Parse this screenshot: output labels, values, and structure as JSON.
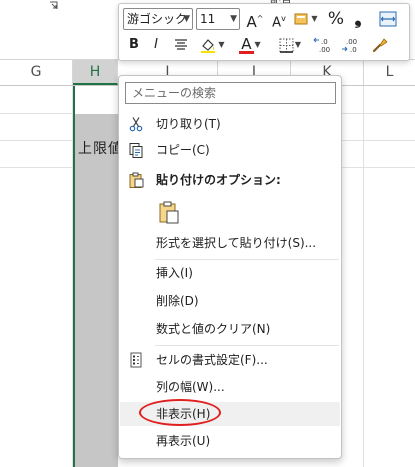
{
  "ribbon": {
    "group_label": "配置"
  },
  "columns": [
    {
      "label": "G",
      "selected": false
    },
    {
      "label": "H",
      "selected": true
    },
    {
      "label": "I",
      "selected": false
    },
    {
      "label": "J",
      "selected": false
    },
    {
      "label": "K",
      "selected": false
    },
    {
      "label": "L",
      "selected": false
    }
  ],
  "cell": {
    "text": "上限値"
  },
  "mini_toolbar": {
    "font_name": "游ゴシック",
    "font_size": "11",
    "grow_font": "A",
    "shrink_font": "A",
    "percent": "%",
    "comma": "❟",
    "bold": "B",
    "italic": "I",
    "font_color": "A",
    "font_color_value": "#e02020",
    "decimal_increase": "←0 .00",
    "decimal_decrease": ".00 →0"
  },
  "context_menu": {
    "search_placeholder": "メニューの検索",
    "items": {
      "cut": "切り取り(T)",
      "copy": "コピー(C)",
      "paste_options": "貼り付けのオプション:",
      "paste_special": "形式を選択して貼り付け(S)...",
      "insert": "挿入(I)",
      "delete": "削除(D)",
      "clear_contents": "数式と値のクリア(N)",
      "format_cells": "セルの書式設定(F)...",
      "column_width": "列の幅(W)...",
      "hide": "非表示(H)",
      "unhide": "再表示(U)"
    },
    "highlight_color": "#e02020"
  }
}
